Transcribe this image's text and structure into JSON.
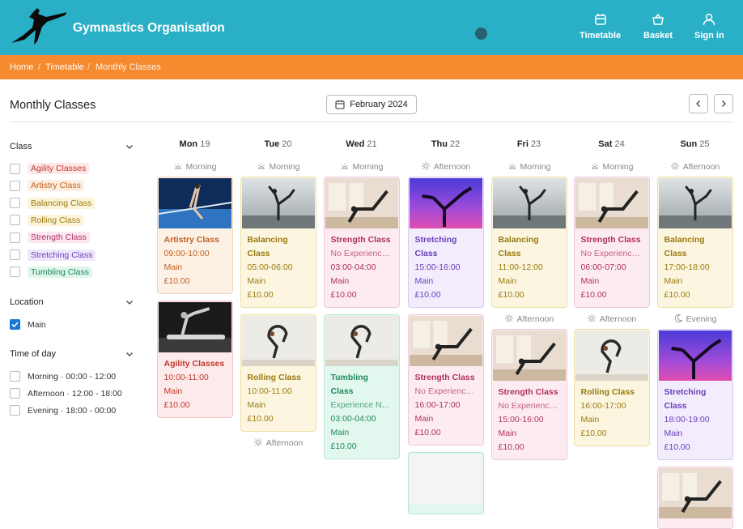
{
  "header": {
    "brand": "Gymnastics Organisation",
    "nav": [
      {
        "label": "Timetable",
        "icon": "calendar-icon"
      },
      {
        "label": "Basket",
        "icon": "basket-icon"
      },
      {
        "label": "Sign in",
        "icon": "user-icon"
      }
    ]
  },
  "breadcrumb": [
    "Home",
    "Timetable",
    "Monthly Classes"
  ],
  "breadcrumb_sep": "/",
  "page_title": "Monthly Classes",
  "month_label": "February 2024",
  "filters": {
    "class": {
      "title": "Class",
      "items": [
        {
          "label": "Agility Classes",
          "color": "#c0392b",
          "bg": "#fde8e8"
        },
        {
          "label": "Artistry Class",
          "color": "#c0601e",
          "bg": "#fdeee2"
        },
        {
          "label": "Balancing Class",
          "color": "#9a7a10",
          "bg": "#fcf4d8"
        },
        {
          "label": "Rolling Class",
          "color": "#9a7a10",
          "bg": "#fcf4d8"
        },
        {
          "label": "Strength Class",
          "color": "#b03060",
          "bg": "#fce6ef"
        },
        {
          "label": "Stretching Class",
          "color": "#6a3fb8",
          "bg": "#efe8fc"
        },
        {
          "label": "Tumbling Class",
          "color": "#1f8a5c",
          "bg": "#dff6ec"
        }
      ]
    },
    "location": {
      "title": "Location",
      "items": [
        {
          "label": "Main",
          "checked": true
        }
      ]
    },
    "time": {
      "title": "Time of day",
      "items": [
        {
          "label": "Morning · 00:00 - 12:00"
        },
        {
          "label": "Afternoon · 12:00 - 18:00"
        },
        {
          "label": "Evening · 18:00 - 00:00"
        }
      ]
    }
  },
  "days": [
    {
      "name": "Mon",
      "num": "19",
      "slots": [
        {
          "label": "Morning",
          "icon": "sun-horizon-icon",
          "cards": [
            {
              "cls": "Artistry Class",
              "time": "09:00-10:00",
              "loc": "Main",
              "price": "£10.00",
              "theme": "artistry",
              "img": "gym"
            },
            {
              "cls": "Agility Classes",
              "time": "10:00-11:00",
              "loc": "Main",
              "price": "£10.00",
              "theme": "agility",
              "img": "bw"
            }
          ]
        }
      ]
    },
    {
      "name": "Tue",
      "num": "20",
      "slots": [
        {
          "label": "Morning",
          "icon": "sun-horizon-icon",
          "cards": [
            {
              "cls": "Balancing Class",
              "time": "05:00-06:00",
              "loc": "Main",
              "price": "£10.00",
              "theme": "balancing",
              "img": "yoga"
            },
            {
              "cls": "Rolling Class",
              "time": "10:00-11:00",
              "loc": "Main",
              "price": "£10.00",
              "theme": "rolling",
              "img": "studio"
            }
          ]
        },
        {
          "label": "Afternoon",
          "icon": "sun-icon",
          "cards": []
        }
      ]
    },
    {
      "name": "Wed",
      "num": "21",
      "slots": [
        {
          "label": "Morning",
          "icon": "sun-horizon-icon",
          "cards": [
            {
              "cls": "Strength Class",
              "sub": "No Experience ...",
              "time": "03:00-04:00",
              "loc": "Main",
              "price": "£10.00",
              "theme": "strength",
              "img": "room"
            },
            {
              "cls": "Tumbling Class",
              "sub": "Experience Ne...",
              "time": "03:00-04:00",
              "loc": "Main",
              "price": "£10.00",
              "theme": "tumbling",
              "img": "studio"
            }
          ]
        }
      ]
    },
    {
      "name": "Thu",
      "num": "22",
      "slots": [
        {
          "label": "Afternoon",
          "icon": "sun-icon",
          "cards": [
            {
              "cls": "Stretching Class",
              "time": "15:00-16:00",
              "loc": "Main",
              "price": "£10.00",
              "theme": "stretching",
              "img": "purple"
            },
            {
              "cls": "Strength Class",
              "sub": "No Experience ...",
              "time": "16:00-17:00",
              "loc": "Main",
              "price": "£10.00",
              "theme": "strength",
              "img": "room"
            },
            {
              "cls": "",
              "time": "",
              "loc": "",
              "price": "",
              "theme": "tumbling",
              "img": "none"
            }
          ]
        }
      ]
    },
    {
      "name": "Fri",
      "num": "23",
      "slots": [
        {
          "label": "Morning",
          "icon": "sun-horizon-icon",
          "cards": [
            {
              "cls": "Balancing Class",
              "time": "11:00-12:00",
              "loc": "Main",
              "price": "£10.00",
              "theme": "balancing",
              "img": "yoga"
            }
          ]
        },
        {
          "label": "Afternoon",
          "icon": "sun-icon",
          "cards": [
            {
              "cls": "Strength Class",
              "sub": "No Experience ...",
              "time": "15:00-16:00",
              "loc": "Main",
              "price": "£10.00",
              "theme": "strength",
              "img": "room"
            }
          ]
        }
      ]
    },
    {
      "name": "Sat",
      "num": "24",
      "slots": [
        {
          "label": "Morning",
          "icon": "sun-horizon-icon",
          "cards": [
            {
              "cls": "Strength Class",
              "sub": "No Experience ...",
              "time": "06:00-07:00",
              "loc": "Main",
              "price": "£10.00",
              "theme": "strength",
              "img": "room"
            }
          ]
        },
        {
          "label": "Afternoon",
          "icon": "sun-icon",
          "cards": [
            {
              "cls": "Rolling Class",
              "time": "16:00-17:00",
              "loc": "Main",
              "price": "£10.00",
              "theme": "rolling",
              "img": "studio"
            }
          ]
        }
      ]
    },
    {
      "name": "Sun",
      "num": "25",
      "slots": [
        {
          "label": "Afternoon",
          "icon": "sun-icon",
          "cards": [
            {
              "cls": "Balancing Class",
              "time": "17:00-18:00",
              "loc": "Main",
              "price": "£10.00",
              "theme": "balancing",
              "img": "yoga"
            }
          ]
        },
        {
          "label": "Evening",
          "icon": "moon-icon",
          "cards": [
            {
              "cls": "Stretching Class",
              "time": "18:00-19:00",
              "loc": "Main",
              "price": "£10.00",
              "theme": "stretching",
              "img": "purple"
            },
            {
              "cls": "",
              "time": "",
              "loc": "",
              "price": "",
              "theme": "strength",
              "img": "room"
            }
          ]
        }
      ]
    }
  ],
  "themes": {
    "artistry": {
      "bg": "#fdf1e6",
      "border": "#f3d4b8",
      "color": "#c0601e"
    },
    "agility": {
      "bg": "#fdeaea",
      "border": "#f3c6c6",
      "color": "#c0392b"
    },
    "balancing": {
      "bg": "#fcf6e0",
      "border": "#eedfa6",
      "color": "#9a7a10"
    },
    "rolling": {
      "bg": "#fcf6e0",
      "border": "#eedfa6",
      "color": "#9a7a10"
    },
    "strength": {
      "bg": "#fcecf2",
      "border": "#f0c6d6",
      "color": "#b03060"
    },
    "stretching": {
      "bg": "#f2ecfd",
      "border": "#d8c8f3",
      "color": "#6a3fb8"
    },
    "tumbling": {
      "bg": "#e2f7ee",
      "border": "#b8e6d0",
      "color": "#1f8a5c"
    }
  }
}
